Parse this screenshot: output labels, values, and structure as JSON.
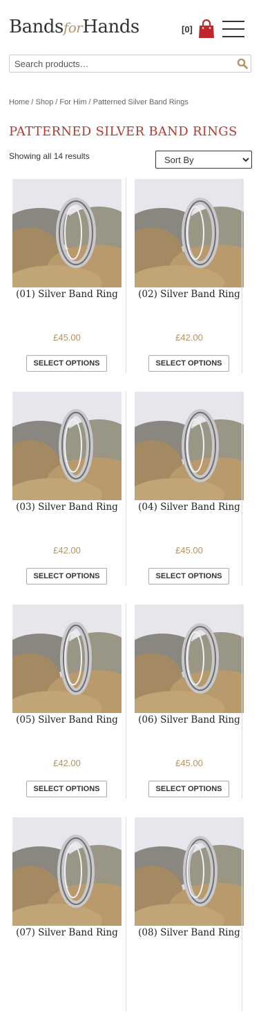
{
  "header": {
    "logo_bands": "Bands",
    "logo_for": "for",
    "logo_hands": "Hands",
    "cart_count": "[0]",
    "cart_icon": "shopping-bag-icon",
    "menu_icon": "hamburger-menu-icon"
  },
  "search": {
    "placeholder": "Search products…",
    "icon": "search-icon"
  },
  "breadcrumb": [
    "Home",
    "Shop",
    "For Him",
    "Patterned Silver Band Rings"
  ],
  "page_title": "PATTERNED SILVER BAND RINGS",
  "result_count": "Showing all 14 results",
  "sort": {
    "selected": "Sort By"
  },
  "colors": {
    "accent": "#b43a2f",
    "price": "#b39466",
    "cart": "#c0272d"
  },
  "products": [
    {
      "name": "(01) Silver Band Ring",
      "price": "£45.00",
      "button": "SELECT OPTIONS"
    },
    {
      "name": "(02) Silver Band Ring",
      "price": "£42.00",
      "button": "SELECT OPTIONS"
    },
    {
      "name": "(03) Silver Band Ring",
      "price": "£42.00",
      "button": "SELECT OPTIONS"
    },
    {
      "name": "(04) Silver Band Ring",
      "price": "£45.00",
      "button": "SELECT OPTIONS"
    },
    {
      "name": "(05) Silver Band Ring",
      "price": "£42.00",
      "button": "SELECT OPTIONS"
    },
    {
      "name": "(06) Silver Band Ring",
      "price": "£45.00",
      "button": "SELECT OPTIONS"
    },
    {
      "name": "(07) Silver Band Ring",
      "price": "",
      "button": ""
    },
    {
      "name": "(08) Silver Band Ring",
      "price": "",
      "button": ""
    }
  ]
}
